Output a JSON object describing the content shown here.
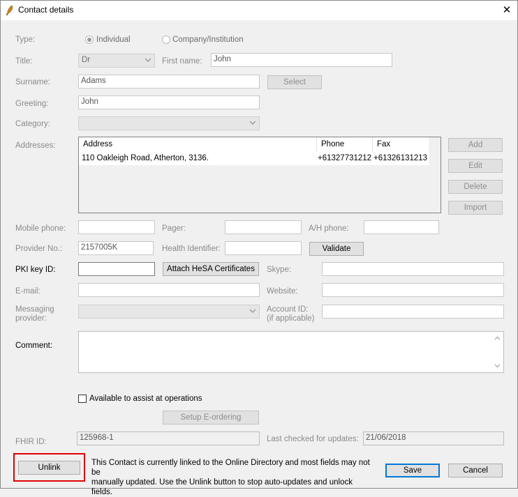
{
  "window": {
    "title": "Contact details",
    "close_glyph": "✕"
  },
  "type": {
    "label": "Type:",
    "options": [
      "Individual",
      "Company/Institution"
    ],
    "selected": "Individual"
  },
  "title_field": {
    "label": "Title:",
    "value": "Dr"
  },
  "first_name": {
    "label": "First name:",
    "value": "John"
  },
  "surname": {
    "label": "Surname:",
    "value": "Adams",
    "select_button": "Select"
  },
  "greeting": {
    "label": "Greeting:",
    "value": "John"
  },
  "category": {
    "label": "Category:",
    "value": ""
  },
  "addresses": {
    "label": "Addresses:",
    "columns": [
      "Address",
      "Phone",
      "Fax"
    ],
    "rows": [
      {
        "address": "110 Oakleigh Road, Atherton, 3136.",
        "phone": "+61327731212",
        "fax": "+61326131213"
      }
    ],
    "buttons": {
      "add": "Add",
      "edit": "Edit",
      "delete": "Delete",
      "import": "Import"
    }
  },
  "mobile_phone": {
    "label": "Mobile phone:",
    "value": ""
  },
  "pager": {
    "label": "Pager:",
    "value": ""
  },
  "ah_phone": {
    "label": "A/H phone:",
    "value": ""
  },
  "provider_no": {
    "label": "Provider No.:",
    "value": "2157005K"
  },
  "health_identifier": {
    "label": "Health Identifier:",
    "value": "",
    "validate_button": "Validate"
  },
  "pki_key": {
    "label": "PKI key ID:",
    "value": "",
    "attach_button": "Attach HeSA Certificates"
  },
  "skype": {
    "label": "Skype:",
    "value": ""
  },
  "email": {
    "label": "E-mail:",
    "value": ""
  },
  "website": {
    "label": "Website:",
    "value": ""
  },
  "messaging_provider": {
    "label_line1": "Messaging",
    "label_line2": "provider:",
    "value": ""
  },
  "account_id": {
    "label_line1": "Account ID:",
    "label_line2": "(if applicable)",
    "value": ""
  },
  "comment": {
    "label": "Comment:",
    "value": ""
  },
  "assist_operations": {
    "label": "Available to assist at operations",
    "checked": false
  },
  "setup_eordering": {
    "label": "Setup E-ordering"
  },
  "fhir_id": {
    "label": "FHIR ID:",
    "value": "125968-1"
  },
  "last_checked": {
    "label": "Last checked for updates:",
    "value": "21/06/2018"
  },
  "footer": {
    "unlink_button": "Unlink",
    "note_line1": "This Contact is currently linked to the Online Directory and most fields may not be",
    "note_line2": "manually updated. Use the Unlink button to stop auto-updates and unlock fields.",
    "save_button": "Save",
    "cancel_button": "Cancel"
  },
  "colors": {
    "accent": "#0078d7",
    "highlight": "#e00000",
    "disabled_text": "#8a8a8a"
  }
}
